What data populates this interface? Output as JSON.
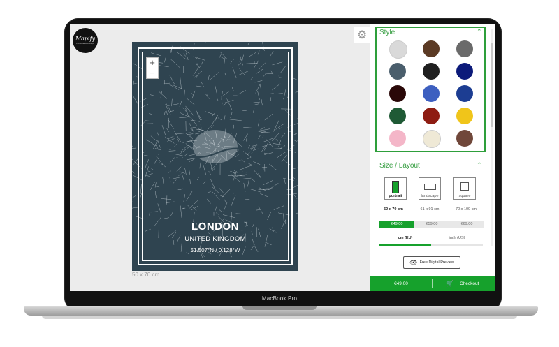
{
  "device": {
    "label": "MacBook Pro"
  },
  "brand": {
    "logo_text": "Mapify",
    "logo_subtext": "Personalized Maps"
  },
  "map": {
    "zoom_in": "+",
    "zoom_out": "−",
    "city": "LONDON",
    "country": "UNITED KINGDOM",
    "coords": "51.507°N / 0.128°W",
    "poster_color": "#2f4450",
    "size_caption": "50 x 70 cm"
  },
  "style_section": {
    "title": "Style",
    "swatches": [
      "#d9d9d9",
      "#5b3a24",
      "#6a6a6a",
      "#4a5e6c",
      "#1f1f1f",
      "#0c1a7a",
      "#2a0808",
      "#3d5fc0",
      "#1c3d92",
      "#1f5a35",
      "#8e1c12",
      "#f0c51a",
      "#f4b6c8",
      "#efe9d6",
      "#70473a"
    ]
  },
  "size_section": {
    "title": "Size / Layout",
    "orientations": [
      {
        "label": "portrait",
        "selected": true
      },
      {
        "label": "landscape",
        "selected": false
      },
      {
        "label": "square",
        "selected": false
      }
    ],
    "dimensions": [
      "50 x 70 cm",
      "61 x 91 cm",
      "70 x 100 cm"
    ],
    "prices": [
      "€49.00",
      "€59.00",
      "€69.00"
    ],
    "units": [
      "cm (EU)",
      "inch (US)"
    ]
  },
  "preview_button": {
    "label": "Free Digital Preview"
  },
  "checkout": {
    "total": "€49.00",
    "label": "Checkout"
  },
  "colors": {
    "accent": "#16a12c"
  }
}
